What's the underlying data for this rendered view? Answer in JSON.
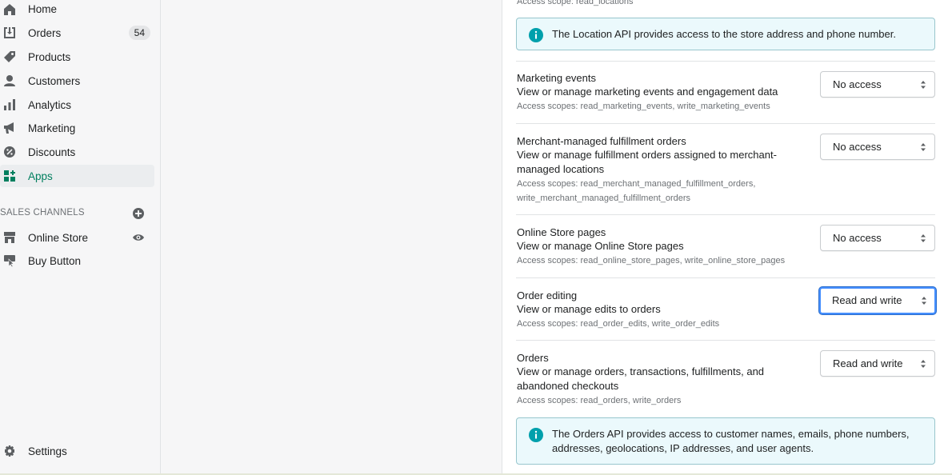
{
  "sidebar": {
    "items": [
      {
        "label": "Home",
        "icon": "home-icon"
      },
      {
        "label": "Orders",
        "icon": "orders-icon",
        "badge": "54"
      },
      {
        "label": "Products",
        "icon": "tag-icon"
      },
      {
        "label": "Customers",
        "icon": "person-icon"
      },
      {
        "label": "Analytics",
        "icon": "bar-chart-icon"
      },
      {
        "label": "Marketing",
        "icon": "megaphone-icon"
      },
      {
        "label": "Discounts",
        "icon": "discount-icon"
      },
      {
        "label": "Apps",
        "icon": "apps-icon",
        "active": true
      }
    ],
    "sales_channels_title": "SALES CHANNELS",
    "channels": [
      {
        "label": "Online Store",
        "icon": "store-icon"
      },
      {
        "label": "Buy Button",
        "icon": "buy-button-icon"
      }
    ],
    "settings_label": "Settings"
  },
  "content": {
    "top_scope": "Access scope: read_locations",
    "location_banner": "The Location API provides access to the store address and phone number.",
    "permissions": [
      {
        "title": "Marketing events",
        "description": "View or manage marketing events and engagement data",
        "scopes": "Access scopes: read_marketing_events, write_marketing_events",
        "access": "No access"
      },
      {
        "title": "Merchant-managed fulfillment orders",
        "description": "View or manage fulfillment orders assigned to merchant-managed locations",
        "scopes": "Access scopes: read_merchant_managed_fulfillment_orders, write_merchant_managed_fulfillment_orders",
        "access": "No access"
      },
      {
        "title": "Online Store pages",
        "description": "View or manage Online Store pages",
        "scopes": "Access scopes: read_online_store_pages, write_online_store_pages",
        "access": "No access"
      },
      {
        "title": "Order editing",
        "description": "View or manage edits to orders",
        "scopes": "Access scopes: read_order_edits, write_order_edits",
        "access": "Read and write"
      },
      {
        "title": "Orders",
        "description": "View or manage orders, transactions, fulfillments, and abandoned checkouts",
        "scopes": "Access scopes: read_orders, write_orders",
        "access": "Read and write"
      }
    ],
    "orders_banner": "The Orders API provides access to customer names, emails, phone numbers, addresses, geolocations, IP addresses, and user agents."
  },
  "colors": {
    "accent_green": "#007f5f",
    "banner_bg": "#ebf9fc",
    "banner_icon": "#00a0ac",
    "focus_blue": "#458fff"
  }
}
